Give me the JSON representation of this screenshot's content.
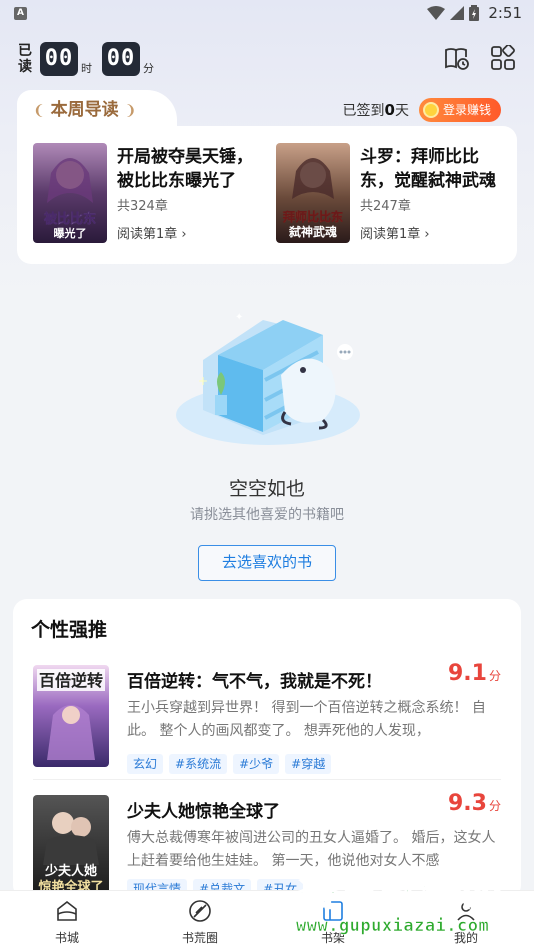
{
  "status_bar": {
    "notif_icon": "A",
    "time": "2:51"
  },
  "reading_time": {
    "label": "已读",
    "hours": "00",
    "hours_unit": "时",
    "minutes": "00",
    "minutes_unit": "分"
  },
  "header_icons": [
    "book-history-icon",
    "grid-apps-icon"
  ],
  "weekly_guide": {
    "title": "本周导读",
    "signin_prefix": "已签到",
    "signin_days": "0",
    "signin_suffix": "天",
    "signin_button": "登录赚钱",
    "books": [
      {
        "title": "开局被夺昊天锤，被比比东曝光了",
        "chapters": "共324章",
        "read": "阅读第1章",
        "cover_text": "被比比东曝光了",
        "cover_color": "#3a2a4a"
      },
      {
        "title": "斗罗：拜师比比东，觉醒弑神武魂",
        "chapters": "共247章",
        "read": "阅读第1章",
        "cover_text": "拜师比比东弑神武魂",
        "cover_color": "#4a2a2a"
      }
    ]
  },
  "empty_state": {
    "title": "空空如也",
    "subtitle": "请挑选其他喜爱的书籍吧",
    "button": "去选喜欢的书"
  },
  "recommend": {
    "title": "个性强推",
    "score_unit": "分",
    "items": [
      {
        "name": "百倍逆转：气不气，我就是不死！",
        "score": "9.1",
        "desc": "王小兵穿越到异世界！ 得到一个百倍逆转之概念系统！ 自此。 整个人的画风都变了。 想弄死他的人发现，",
        "tags": [
          "玄幻",
          "#系统流",
          "#少爷",
          "#穿越"
        ],
        "cover_text": "百倍逆转",
        "cover_color": "#5a3a7a"
      },
      {
        "name": "少夫人她惊艳全球了",
        "score": "9.3",
        "desc": "傅大总裁傅寒年被闯进公司的丑女人逼婚了。 婚后，这女人上赶着要给他生娃娃。 第一天，他说他对女人不感",
        "tags": [
          "现代言情",
          "#总裁文",
          "#丑女"
        ],
        "cover_text": "少夫人她惊艳全球了",
        "cover_color": "#2a2a2a"
      }
    ]
  },
  "bottom_nav": [
    {
      "label": "书城",
      "icon": "bookstore-icon"
    },
    {
      "label": "书荒圈",
      "icon": "compass-icon"
    },
    {
      "label": "书架",
      "icon": "bookshelf-icon"
    },
    {
      "label": "我的",
      "icon": "profile-icon"
    }
  ],
  "watermark": {
    "text": "谷普软件园",
    "url": "www.gupuxiazai.com"
  }
}
